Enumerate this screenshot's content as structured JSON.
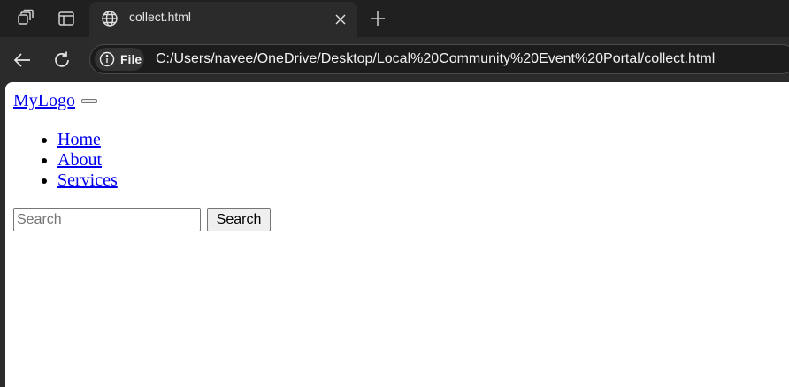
{
  "browser": {
    "tab": {
      "title": "collect.html"
    },
    "address_bar": {
      "scheme_label": "File",
      "url": "C:/Users/navee/OneDrive/Desktop/Local%20Community%20Event%20Portal/collect.html"
    },
    "icons": {
      "workspaces": "workspaces-icon",
      "tab_actions": "tab-actions-icon",
      "favicon": "globe-icon",
      "close_tab": "close-icon",
      "new_tab": "plus-icon",
      "back": "back-arrow-icon",
      "refresh": "refresh-icon",
      "site_info": "info-icon"
    }
  },
  "page": {
    "logo": "MyLogo",
    "nav": {
      "items": [
        {
          "label": "Home"
        },
        {
          "label": "About"
        },
        {
          "label": "Services"
        }
      ]
    },
    "search": {
      "placeholder": "Search",
      "value": "",
      "button_label": "Search"
    }
  },
  "colors": {
    "link": "#0000ee",
    "chrome_dark": "#202020",
    "toolbar": "#2b2b2b",
    "page_bg": "#ffffff"
  }
}
